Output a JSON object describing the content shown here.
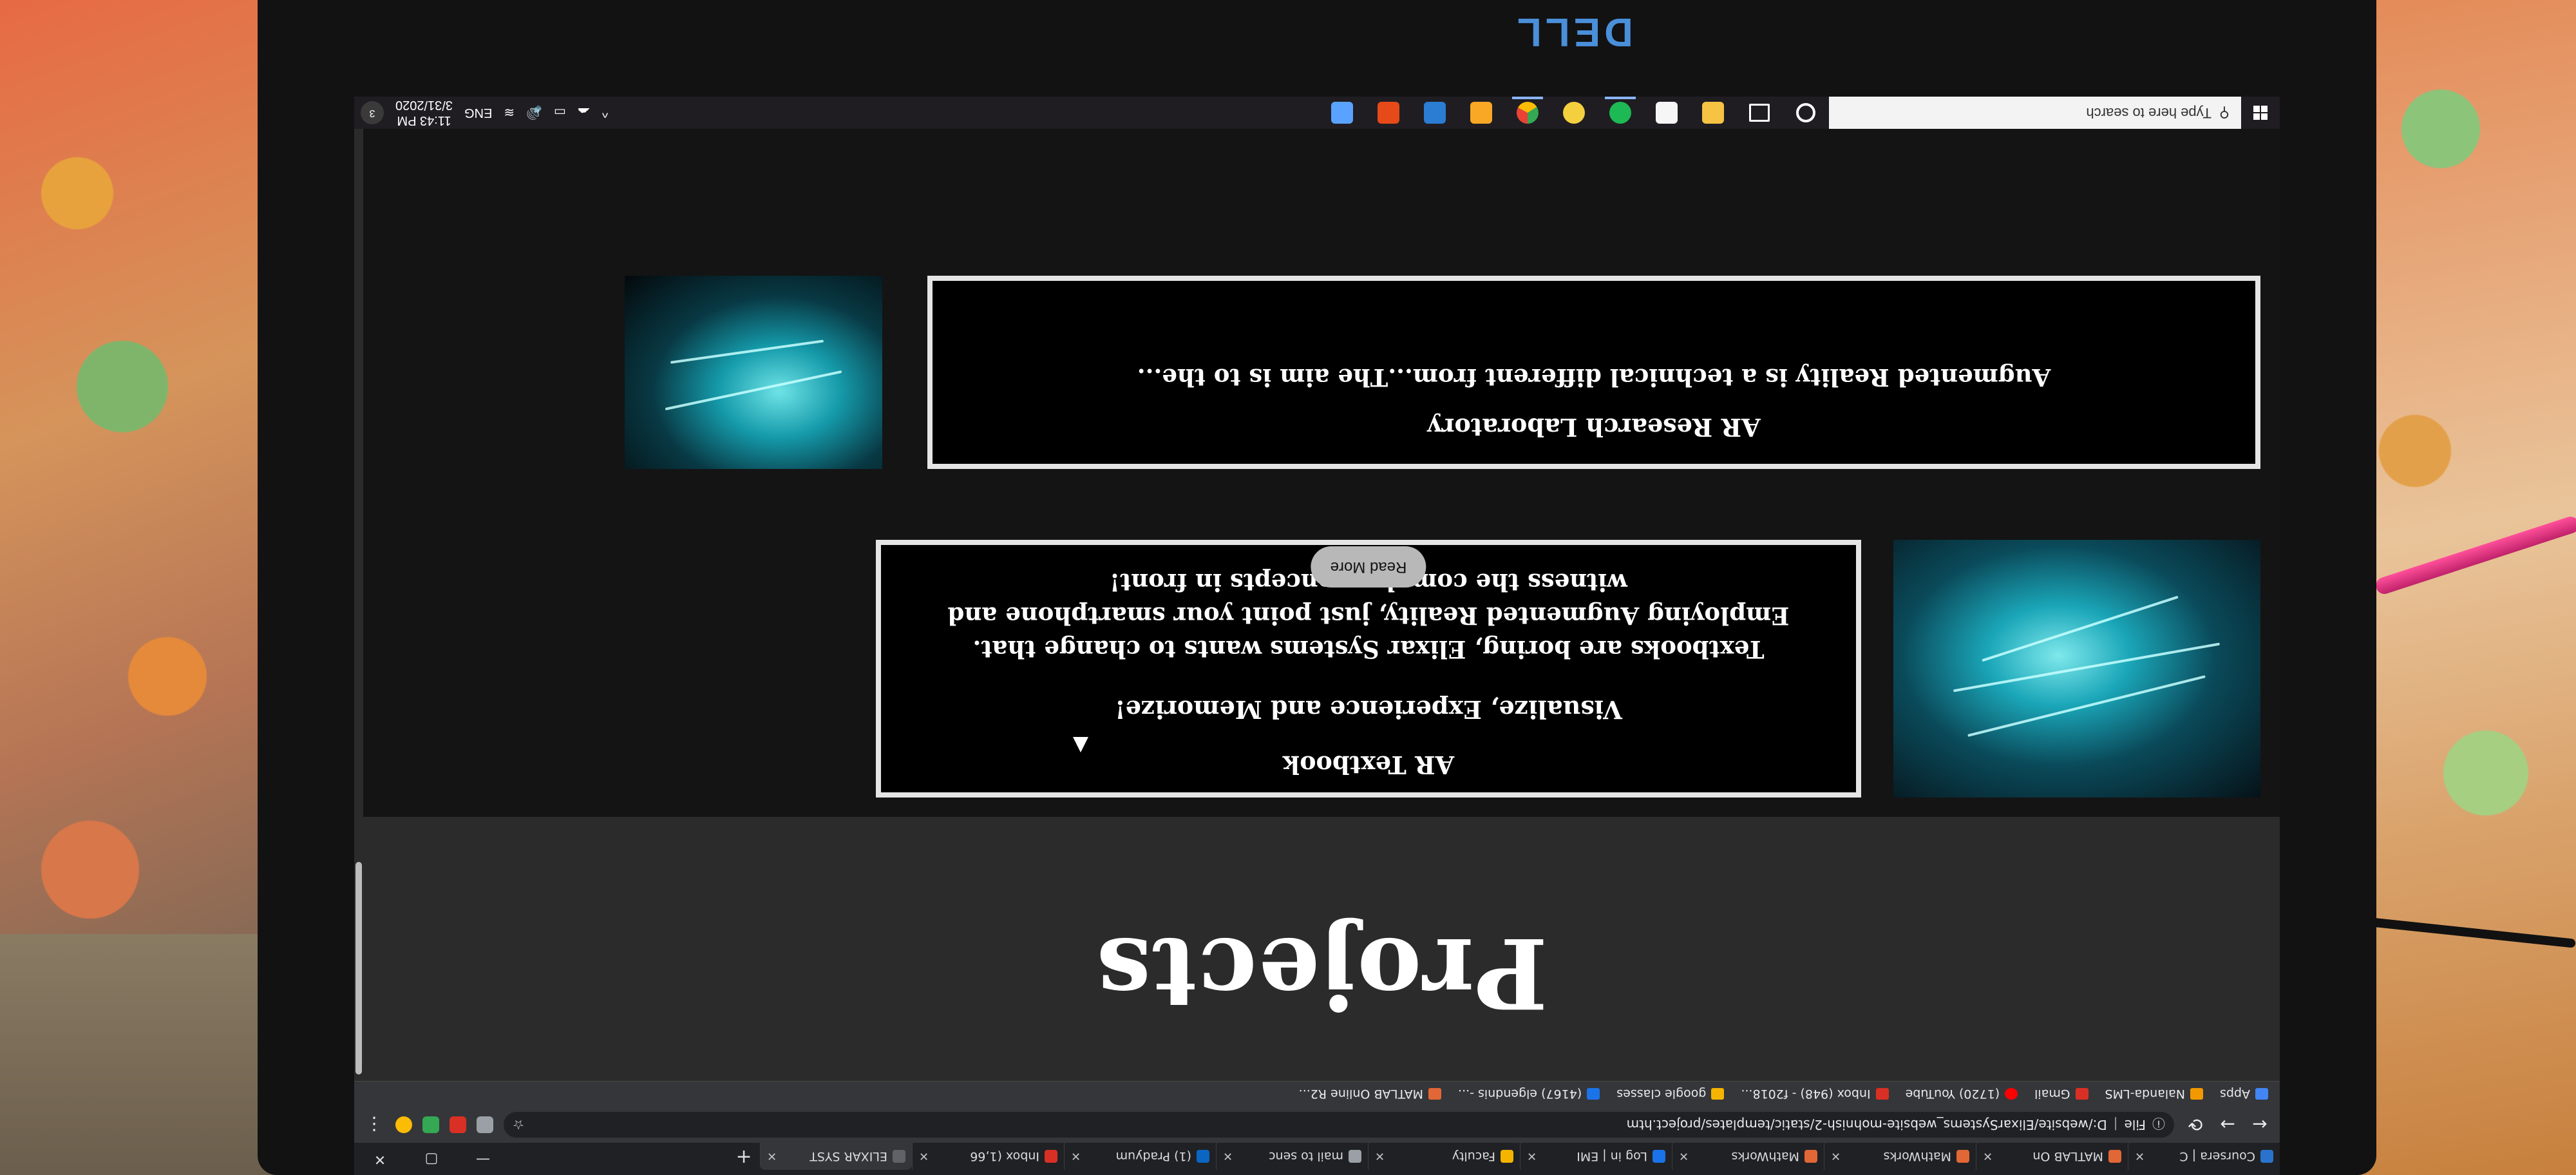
{
  "brand": {
    "logo": "DELL",
    "logo_color": "#4a8fd9"
  },
  "browser": {
    "tabs": [
      {
        "label": "Coursera | C",
        "color": "#2a73cc",
        "active": false
      },
      {
        "label": "MATLAB On",
        "color": "#e16737",
        "active": false
      },
      {
        "label": "MathWorks",
        "color": "#e16737",
        "active": false
      },
      {
        "label": "MathWorks",
        "color": "#e16737",
        "active": false
      },
      {
        "label": "Log in | EMI",
        "color": "#1a73e8",
        "active": false
      },
      {
        "label": "Faculty",
        "color": "#f4b400",
        "active": false
      },
      {
        "label": "mail to senc",
        "color": "#9aa0a6",
        "active": false
      },
      {
        "label": "(1) Pradyum",
        "color": "#0a66c2",
        "active": false
      },
      {
        "label": "Inbox (1,66",
        "color": "#d93025",
        "active": false
      },
      {
        "label": "ELIXAR SYST",
        "color": "#5f6368",
        "active": true
      }
    ],
    "new_tab_label": "+",
    "window_controls": {
      "minimize": "—",
      "maximize": "▢",
      "close": "✕"
    },
    "address": {
      "protocol": "File",
      "url": "D:/website/ElixarSystems_website-mohnish-2/static/templates/project.htm"
    },
    "bookmarks": [
      {
        "label": "Apps",
        "color": "#4285f4"
      },
      {
        "label": "Nalanda-LMS",
        "color": "#f29900"
      },
      {
        "label": "Gmail",
        "color": "#d93025"
      },
      {
        "label": "(1720) YouTube",
        "color": "#ff0000"
      },
      {
        "label": "Inbox (948) - f2018...",
        "color": "#d93025"
      },
      {
        "label": "google classes",
        "color": "#f4b400"
      },
      {
        "label": "(4167) elgendnis -...",
        "color": "#1a73e8"
      },
      {
        "label": "MATLAB Online R2...",
        "color": "#e16737"
      }
    ]
  },
  "page": {
    "title": "Projects",
    "projects": [
      {
        "title": "AR Textbook",
        "subtitle": "Visualize, Experience and Memorize!",
        "description": "Textbooks are boring, Elixar Systems wants to change that. Employing Augmented Reality, just point your smartphone and witness the complex concepts in front!",
        "button": "Read More"
      },
      {
        "title": "AR Research Laboratory",
        "description": "Augmented Reality is a technical different from...The aim is to the..."
      }
    ]
  },
  "taskbar": {
    "search_placeholder": "Type here to search",
    "apps": [
      {
        "name": "cortana-icon",
        "color": "#ffffff",
        "open": false
      },
      {
        "name": "task-view-icon",
        "color": "#ffffff",
        "open": false
      },
      {
        "name": "file-explorer-icon",
        "color": "#f6c343",
        "open": false
      },
      {
        "name": "store-icon",
        "color": "#f6f6f6",
        "open": false
      },
      {
        "name": "spotify-icon",
        "color": "#1db954",
        "open": true
      },
      {
        "name": "pdf-icon",
        "color": "#f4d03f",
        "open": false
      },
      {
        "name": "chrome-icon",
        "color": "#fbbc05",
        "open": true
      },
      {
        "name": "sublime-icon",
        "color": "#f9a825",
        "open": false
      },
      {
        "name": "word-icon",
        "color": "#2b7cd3",
        "open": false
      },
      {
        "name": "office-icon",
        "color": "#e64a19",
        "open": false
      },
      {
        "name": "notes-icon",
        "color": "#5aa2ff",
        "open": false
      }
    ],
    "tray": {
      "language": "ENG",
      "time": "11:43 PM",
      "date": "3/31/2020",
      "notifications": "3"
    }
  }
}
